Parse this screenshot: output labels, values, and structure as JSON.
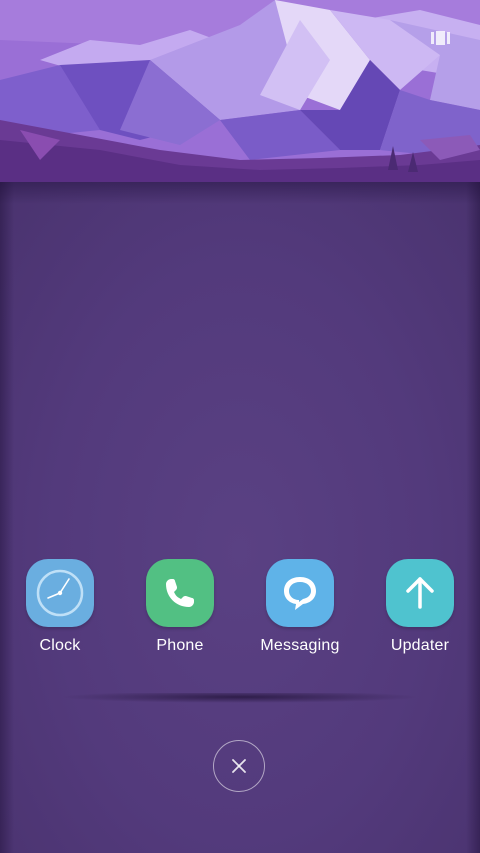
{
  "wallpaper": {
    "icon": "low-poly-mountain-wallpaper",
    "colors": {
      "sky": "#9a6fd6",
      "mountain_light": "#d9c8f4",
      "mountain_mid": "#8d6fd0",
      "mountain_dark": "#5e43a8",
      "foothill": "#6b3c96"
    }
  },
  "header": {
    "edit_icon": "widget-grid-icon"
  },
  "apps": [
    {
      "label": "Clock",
      "icon": "clock-icon",
      "color": "#6aaee0"
    },
    {
      "label": "Phone",
      "icon": "phone-icon",
      "color": "#52c083"
    },
    {
      "label": "Messaging",
      "icon": "message-bubble-icon",
      "color": "#5fb3e8"
    },
    {
      "label": "Updater",
      "icon": "arrow-up-icon",
      "color": "#4fc3cf"
    }
  ],
  "close": {
    "icon": "close-icon"
  },
  "theme": {
    "panel_background": "#533a7c",
    "label_color": "#ffffff"
  }
}
